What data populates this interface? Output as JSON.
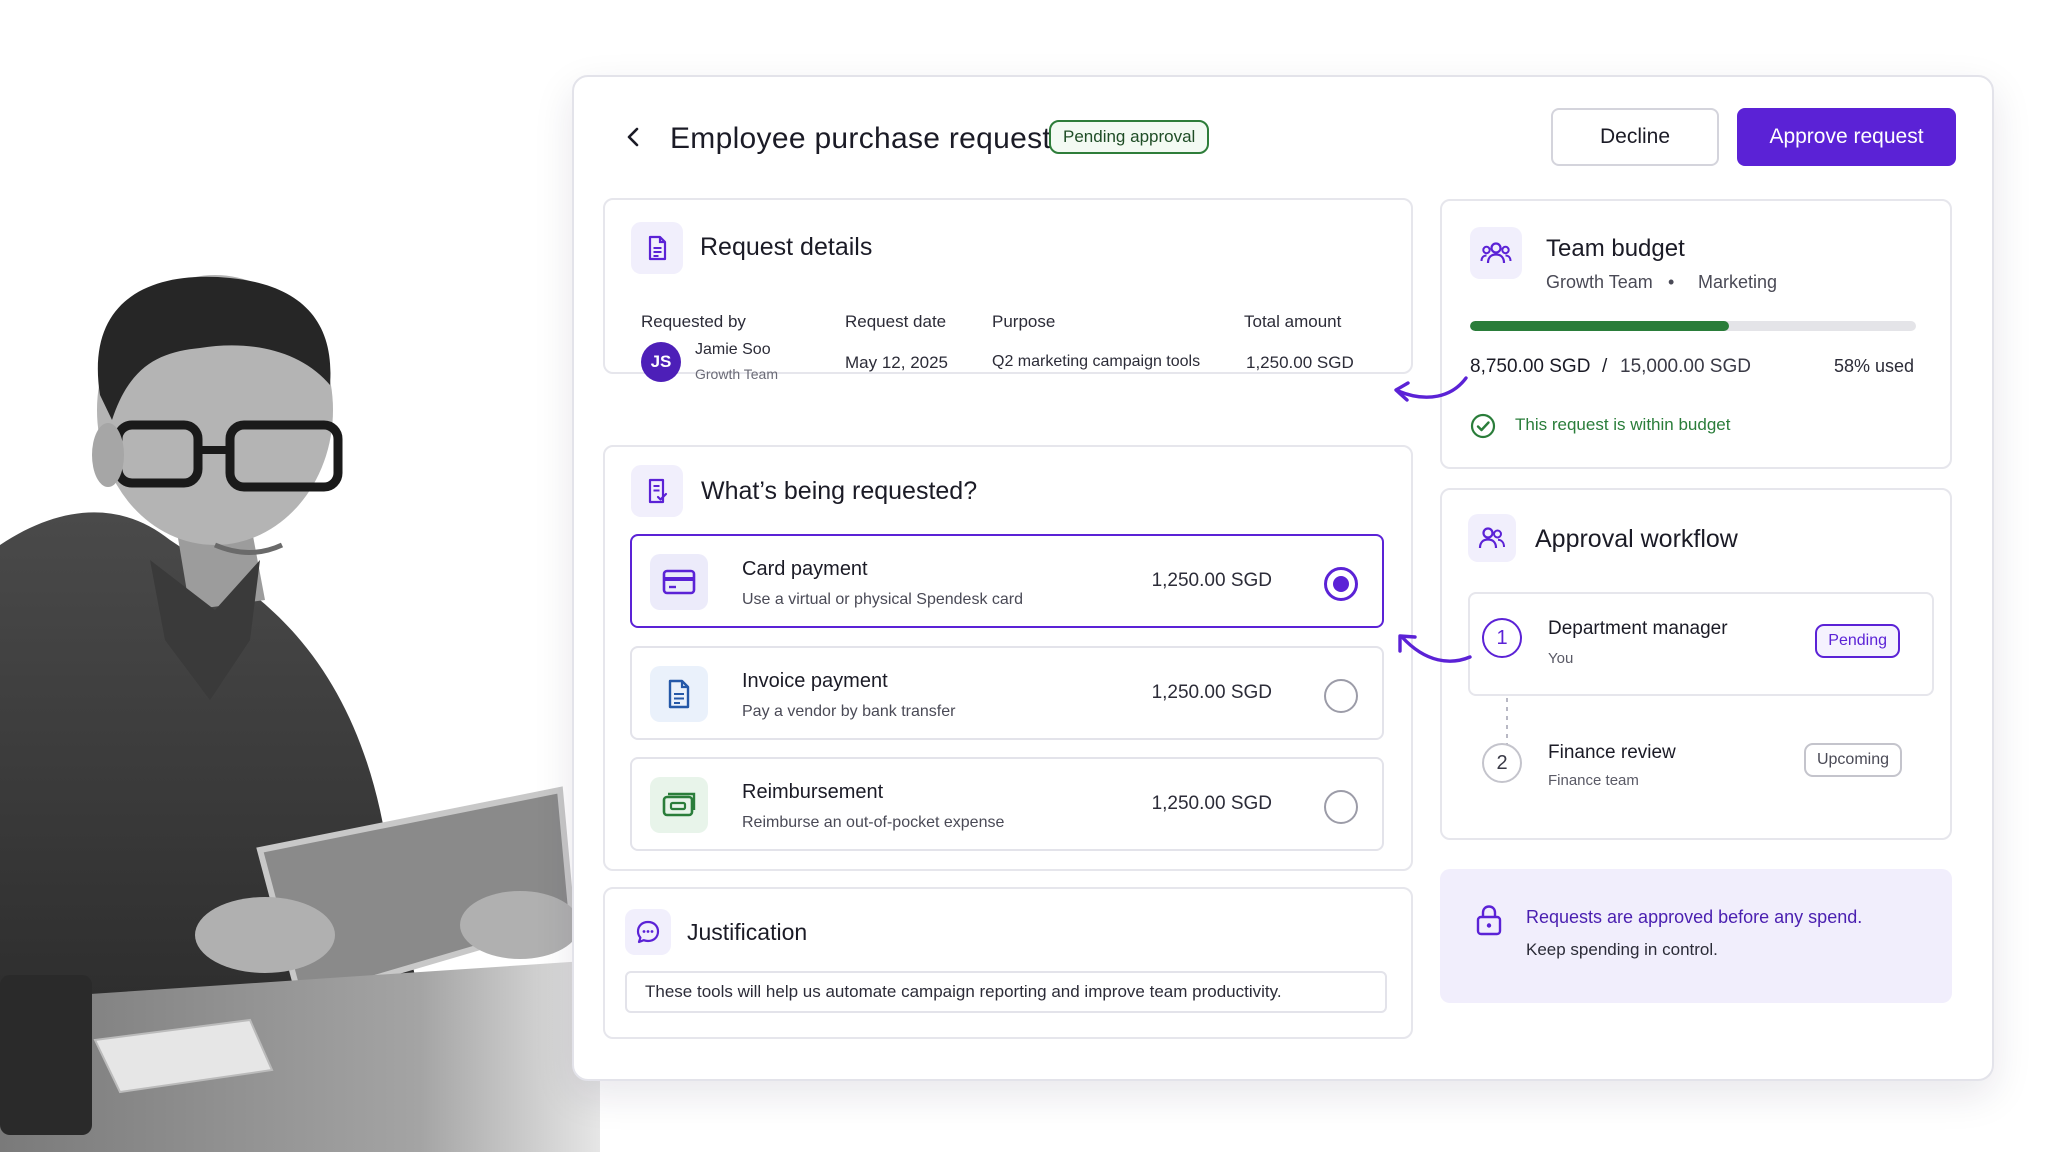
{
  "header": {
    "title": "Employee purchase request",
    "status": "Pending approval",
    "decline_label": "Decline",
    "approve_label": "Approve request"
  },
  "request_details": {
    "title": "Request details",
    "requested_by_label": "Requested by",
    "initials": "JS",
    "name": "Jamie Soo",
    "team": "Growth Team",
    "date_label": "Request date",
    "date": "May 12, 2025",
    "purpose_label": "Purpose",
    "purpose": "Q2 marketing campaign tools",
    "total_label": "Total amount",
    "total": "1,250.00 SGD"
  },
  "requested": {
    "title": "What’s being requested?",
    "options": [
      {
        "title": "Card payment",
        "subtitle": "Use a virtual or physical Spendesk card",
        "amount": "1,250.00 SGD",
        "selected": true,
        "icon": "credit-card-icon"
      },
      {
        "title": "Invoice payment",
        "subtitle": "Pay a vendor by bank transfer",
        "amount": "1,250.00 SGD",
        "selected": false,
        "icon": "invoice-icon"
      },
      {
        "title": "Reimbursement",
        "subtitle": "Reimburse an out-of-pocket expense",
        "amount": "1,250.00 SGD",
        "selected": false,
        "icon": "cash-icon"
      }
    ]
  },
  "justification": {
    "title": "Justification",
    "text": "These tools will help us automate campaign  reporting and improve team productivity."
  },
  "budget": {
    "title": "Team budget",
    "team": "Growth Team",
    "separator": "•",
    "department": "Marketing",
    "spent": "8,750.00 SGD",
    "slash": "/",
    "total": "15,000.00 SGD",
    "used": "58% used",
    "used_fraction": 0.58,
    "status": "This request is within budget"
  },
  "workflow": {
    "title": "Approval workflow",
    "steps": [
      {
        "num": "1",
        "title": "Department manager",
        "subtitle": "You",
        "status": "Pending"
      },
      {
        "num": "2",
        "title": "Finance review",
        "subtitle": "Finance team",
        "status": "Upcoming"
      }
    ]
  },
  "banner": {
    "line1": "Requests are approved before any spend.",
    "line2": "Keep spending in control."
  },
  "colors": {
    "accent": "#5b22d6",
    "success": "#2a7d3a",
    "banner_bg": "#f1eefc"
  }
}
